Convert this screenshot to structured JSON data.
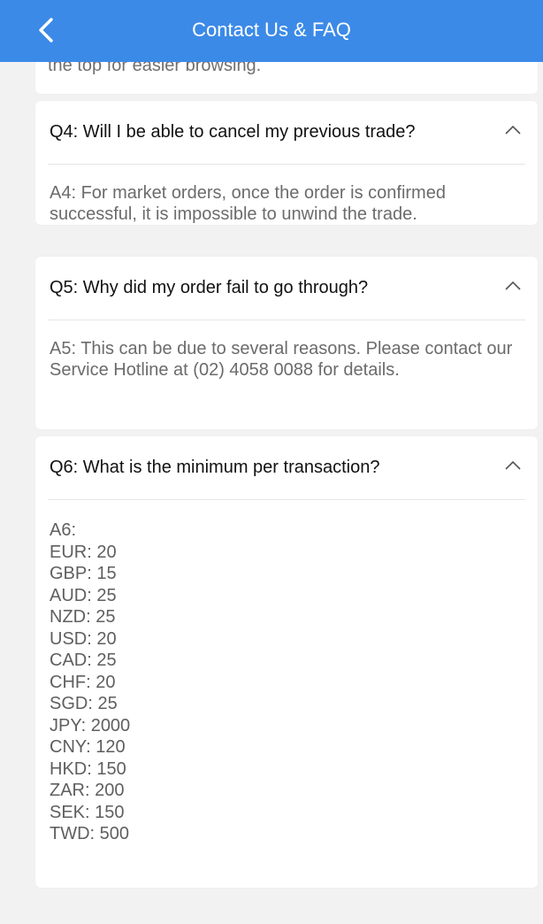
{
  "header": {
    "title": "Contact Us & FAQ",
    "back_icon": "chevron-left-icon"
  },
  "faq_top_partial": {
    "answer_tail": "the top for easier browsing."
  },
  "faq": [
    {
      "question": "Q4: Will I be able to cancel my previous trade?",
      "answer": "A4: For market orders, once the order is confirmed successful, it is impossible to unwind the trade.",
      "expanded": true,
      "toggle_icon": "chevron-up-icon"
    },
    {
      "question": "Q5: Why did my order fail to go through?",
      "answer": "A5: This can be due to several reasons. Please contact our Service Hotline at (02) 4058 0088 for details.",
      "expanded": true,
      "toggle_icon": "chevron-up-icon"
    },
    {
      "question": "Q6: What is the minimum per transaction?",
      "answer_lines": [
        "A6:",
        "EUR: 20",
        "GBP: 15",
        "AUD: 25",
        "NZD: 25",
        "USD: 20",
        "CAD: 25",
        "CHF: 20",
        "SGD: 25",
        "JPY: 2000",
        "CNY: 120",
        "HKD: 150",
        "ZAR: 200",
        "SEK: 150",
        "TWD: 500"
      ],
      "expanded": true,
      "toggle_icon": "chevron-up-icon"
    }
  ],
  "colors": {
    "header_bg": "#3c8ae7",
    "page_bg": "#f2f2f2",
    "card_bg": "#ffffff",
    "question_text": "#111111",
    "answer_text": "#6b6b6b"
  }
}
